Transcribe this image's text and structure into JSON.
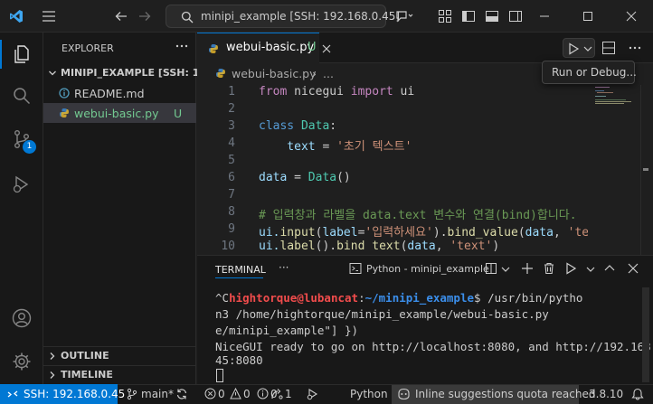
{
  "titlebar": {
    "search_text": "minipi_example [SSH: 192.168.0.45]"
  },
  "explorer": {
    "title": "EXPLORER",
    "folder": "MINIPI_EXAMPLE [SSH: 19...",
    "files": [
      {
        "name": "README.md",
        "status": ""
      },
      {
        "name": "webui-basic.py",
        "status": "U"
      }
    ],
    "outline": "OUTLINE",
    "timeline": "TIMELINE"
  },
  "activity": {
    "scm_badge": "1"
  },
  "editor": {
    "tab_label": "webui-basic.py",
    "tab_status": "U",
    "breadcrumb_file": "webui-basic.py",
    "breadcrumb_more": "...",
    "run_tooltip": "Run or Debug...",
    "line_numbers": [
      "1",
      "2",
      "3",
      "4",
      "5",
      "6",
      "7",
      "8",
      "9",
      "10"
    ],
    "code": {
      "l1_from": "from",
      "l1_mod": " nicegui ",
      "l1_import": "import",
      "l1_name": " ui",
      "l3_class": "class",
      "l3_name": " Data",
      "l3_colon": ":",
      "l4_var": "    text",
      "l4_eq": " = ",
      "l4_str": "'초기 텍스트'",
      "l6_var": "data",
      "l6_eq": " = ",
      "l6_cls": "Data",
      "l6_paren": "()",
      "l8_comment": "# 입력창과 라벨을 data.text 변수와 연결(bind)합니다.",
      "l9_a": "ui.",
      "l9_fn": "input",
      "l9_b": "(",
      "l9_kw": "label",
      "l9_c": "=",
      "l9_str": "'입력하세요'",
      "l9_d": ").",
      "l9_fn2": "bind_value",
      "l9_e": "(",
      "l9_var": "data",
      "l9_f": ", ",
      "l9_str2": "'te",
      "l10_a": "ui.",
      "l10_fn": "label",
      "l10_b": "().",
      "l10_fn2": "bind text",
      "l10_c": "(",
      "l10_var": "data",
      "l10_d": ", ",
      "l10_str": "'text'",
      "l10_e": ")"
    }
  },
  "panel": {
    "tab": "TERMINAL",
    "more": "···",
    "terminal_name": "Python - minipi_example",
    "lines": {
      "prompt_prefix": "^C",
      "user": "hightorque@lubancat",
      "colon": ":",
      "path": "~/minipi_example",
      "cmd": "$ /usr/bin/pytho",
      "l2": "n3 /home/hightorque/minipi_example/webui-basic.py",
      "l3": "e/minipi_example\"] })",
      "l4": "NiceGUI ready to go on http://localhost:8080, and http://192.168.0.",
      "l5": "45:8080"
    }
  },
  "statusbar": {
    "remote": "SSH: 192.168.0.45",
    "branch": "main*",
    "errors": "0",
    "warnings": "0",
    "info": "0",
    "ports": "1",
    "language": "Python",
    "copilot": "Inline suggestions quota reached",
    "version": "3.8.10"
  }
}
